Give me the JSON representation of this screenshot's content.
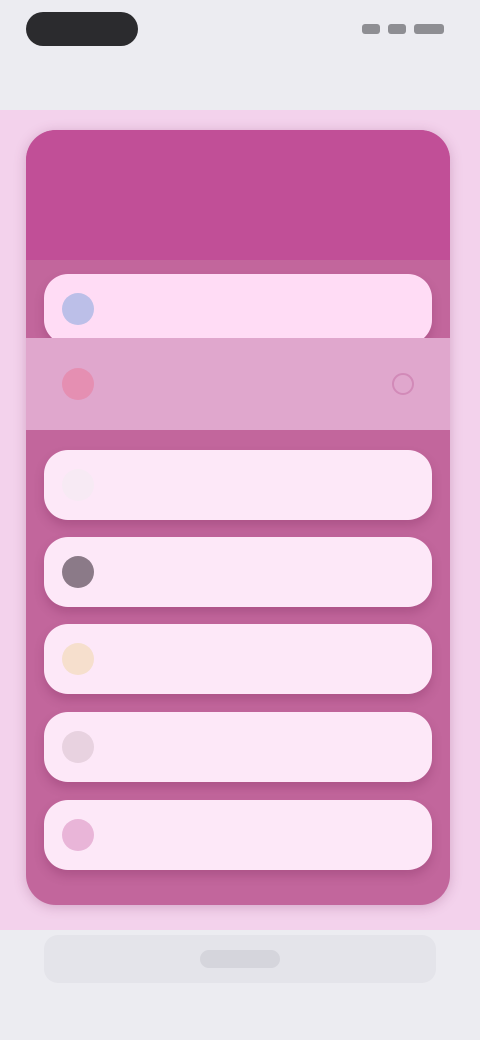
{
  "status": {
    "icons": [
      "signal-icon",
      "wifi-icon",
      "battery-icon"
    ]
  },
  "subtitle": "",
  "modal": {
    "title": "",
    "items": [
      {
        "label": "",
        "icon": "blue-dot-icon",
        "icon_color": "#bcbfe8",
        "state": "selected"
      },
      {
        "label": "",
        "icon": "red-dot-icon",
        "icon_color": "#e58fb2",
        "state": "highlighted"
      },
      {
        "label": "",
        "icon": "white-dot-icon",
        "icon_color": "#f7eaf4",
        "state": "normal"
      },
      {
        "label": "",
        "icon": "grey-dot-icon",
        "icon_color": "#8b7a88",
        "state": "normal"
      },
      {
        "label": "",
        "icon": "yellow-dot-icon",
        "icon_color": "#f6dfcd",
        "state": "normal"
      },
      {
        "label": "",
        "icon": "light-grey-dot-icon",
        "icon_color": "#e8d2e0",
        "state": "normal"
      },
      {
        "label": "",
        "icon": "pink-dot-icon",
        "icon_color": "#e9b5d8",
        "state": "normal"
      }
    ]
  },
  "bottom_bar": {
    "label": ""
  },
  "colors": {
    "header": "#c14f97",
    "modal_body": "#c2669c",
    "row": "#fde8f8",
    "highlight_row": "#e0a7cd",
    "page_background": "#ececf1"
  }
}
